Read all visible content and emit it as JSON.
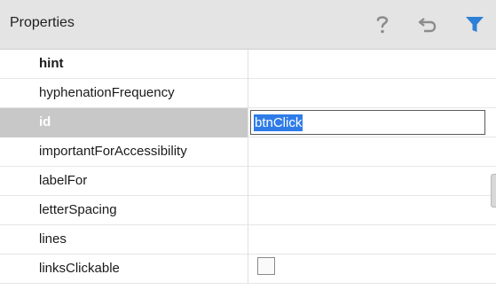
{
  "header": {
    "title": "Properties",
    "icons": {
      "help": "help-icon",
      "undo": "undo-icon",
      "filter": "filter-icon"
    },
    "filter_color": "#2d80d8"
  },
  "rows": [
    {
      "name": "hint",
      "value": ""
    },
    {
      "name": "hyphenationFrequency",
      "value": ""
    },
    {
      "name": "id",
      "value": "btnClick"
    },
    {
      "name": "importantForAccessibility",
      "value": ""
    },
    {
      "name": "labelFor",
      "value": ""
    },
    {
      "name": "letterSpacing",
      "value": ""
    },
    {
      "name": "lines",
      "value": ""
    },
    {
      "name": "linksClickable",
      "value": ""
    }
  ],
  "colors": {
    "selection": "#2f7ce8",
    "selected_row": "#c8c8c8"
  }
}
